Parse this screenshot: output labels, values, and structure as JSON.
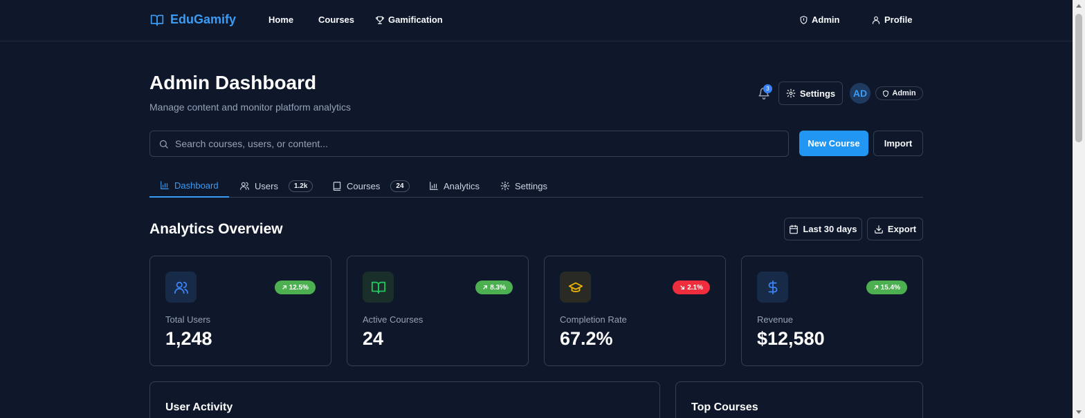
{
  "nav": {
    "brand": "EduGamify",
    "links": [
      "Home",
      "Courses",
      "Gamification"
    ],
    "right": [
      "Admin",
      "Profile"
    ]
  },
  "header": {
    "title": "Admin Dashboard",
    "subtitle": "Manage content and monitor platform analytics",
    "notification_count": "3",
    "settings_label": "Settings",
    "avatar_initials": "AD",
    "role_label": "Admin"
  },
  "search": {
    "placeholder": "Search courses, users, or content...",
    "new_course_label": "New Course",
    "import_label": "Import"
  },
  "tabs": [
    {
      "label": "Dashboard",
      "count": ""
    },
    {
      "label": "Users",
      "count": "1.2k"
    },
    {
      "label": "Courses",
      "count": "24"
    },
    {
      "label": "Analytics",
      "count": ""
    },
    {
      "label": "Settings",
      "count": ""
    }
  ],
  "analytics": {
    "title": "Analytics Overview",
    "range_label": "Last 30 days",
    "export_label": "Export",
    "cards": [
      {
        "label": "Total Users",
        "value": "1,248",
        "trend": "12.5%",
        "direction": "up",
        "icon": "users-icon",
        "color": "#3b82f6"
      },
      {
        "label": "Active Courses",
        "value": "24",
        "trend": "8.3%",
        "direction": "up",
        "icon": "book-open-icon",
        "color": "#22c55e"
      },
      {
        "label": "Completion Rate",
        "value": "67.2%",
        "trend": "2.1%",
        "direction": "down",
        "icon": "graduation-cap-icon",
        "color": "#eab308"
      },
      {
        "label": "Revenue",
        "value": "$12,580",
        "trend": "15.4%",
        "direction": "up",
        "icon": "dollar-icon",
        "color": "#3b82f6"
      }
    ]
  },
  "panels": {
    "user_activity": "User Activity",
    "top_courses": "Top Courses"
  },
  "colors": {
    "accent": "#2196f3",
    "trend_up": "#4caf50",
    "trend_down": "#ef2d3d",
    "background": "#0f172a"
  }
}
